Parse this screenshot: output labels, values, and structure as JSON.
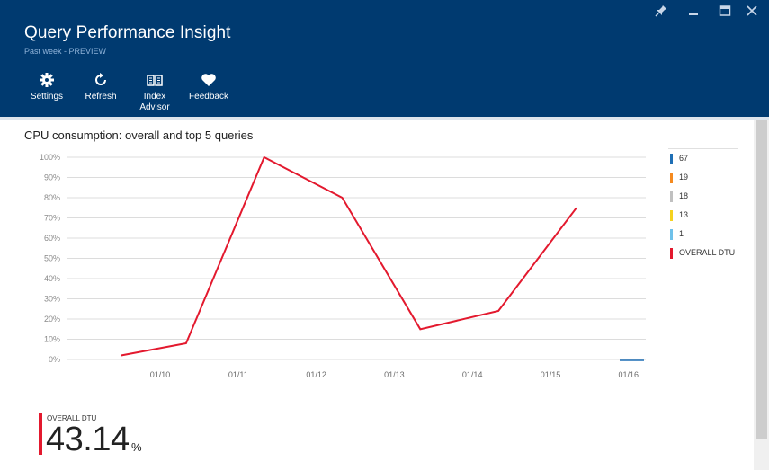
{
  "header": {
    "title": "Query Performance Insight",
    "subtitle": "Past week - PREVIEW",
    "window_controls": [
      {
        "name": "pin-icon",
        "glyph": "✎"
      },
      {
        "name": "minimize-icon",
        "glyph": "—"
      },
      {
        "name": "maximize-icon",
        "glyph": "☐"
      },
      {
        "name": "close-icon",
        "glyph": "✕"
      }
    ],
    "toolbar": [
      {
        "label_lines": [
          "Settings"
        ],
        "icon": "gear-icon"
      },
      {
        "label_lines": [
          "Refresh"
        ],
        "icon": "refresh-icon"
      },
      {
        "label_lines": [
          "Index",
          "Advisor"
        ],
        "icon": "book-icon"
      },
      {
        "label_lines": [
          "Feedback"
        ],
        "icon": "heart-icon"
      }
    ]
  },
  "chart_title": "CPU consumption: overall and top 5 queries",
  "chart_data": {
    "type": "line",
    "title": "CPU consumption: overall and top 5 queries",
    "xlabel": "",
    "ylabel": "",
    "ylim": [
      0,
      100
    ],
    "y_ticks": [
      "100%",
      "90%",
      "80%",
      "70%",
      "60%",
      "50%",
      "40%",
      "30%",
      "20%",
      "10%",
      "0%"
    ],
    "x_ticks": [
      "01/10",
      "01/11",
      "01/12",
      "01/13",
      "01/14",
      "01/15",
      "01/16"
    ],
    "grid": true,
    "legend_position": "right",
    "series": [
      {
        "name": "67",
        "color": "#1f6fb5",
        "values": []
      },
      {
        "name": "19",
        "color": "#f58a1f",
        "values": []
      },
      {
        "name": "18",
        "color": "#c0c0c0",
        "values": []
      },
      {
        "name": "13",
        "color": "#f5d21f",
        "values": []
      },
      {
        "name": "1",
        "color": "#6fc1ea",
        "values": []
      },
      {
        "name": "OVERALL DTU",
        "color": "#e3192e",
        "points": [
          {
            "x": "01/09 12:00",
            "y": 2
          },
          {
            "x": "01/10 08:00",
            "y": 8
          },
          {
            "x": "01/11 08:00",
            "y": 100
          },
          {
            "x": "01/12 08:00",
            "y": 80
          },
          {
            "x": "01/13 08:00",
            "y": 15
          },
          {
            "x": "01/14 08:00",
            "y": 24
          },
          {
            "x": "01/15 08:00",
            "y": 75
          }
        ]
      }
    ]
  },
  "summary": {
    "label": "OVERALL DTU",
    "value": "43.14",
    "unit": "%"
  }
}
